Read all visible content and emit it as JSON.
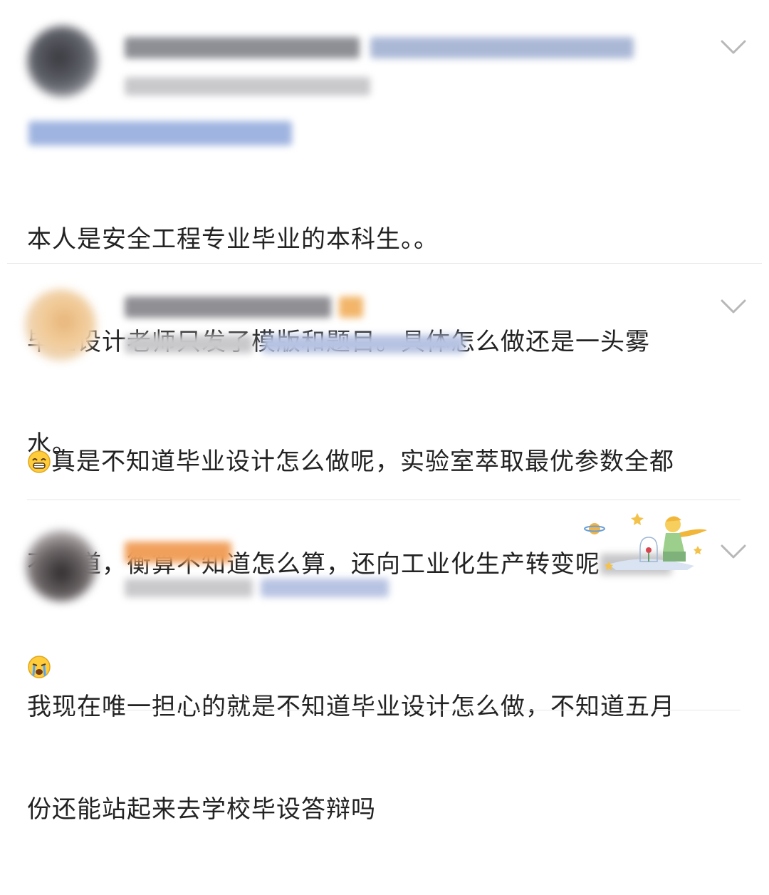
{
  "comments": [
    {
      "content_lines": [
        "本人是安全工程专业毕业的本科生。。",
        "毕业设计老师只发了模版和题目。具体怎么做还是一头雾",
        "水。"
      ]
    },
    {
      "content_line1": "真是不知道毕业设计怎么做呢，实验室萃取最优参数全都",
      "content_line2": "不知道，衡算不知道怎么算，还向工业化生产转变呢",
      "leading_emoji": "grinning-face-icon",
      "trailing_emoji": "crying-face-icon"
    },
    {
      "content_lines": [
        "我现在唯一担心的就是不知道毕业设计怎么做，不知道五月",
        "份还能站起来去学校毕设答辩吗"
      ]
    }
  ],
  "colors": {
    "text": "#222222",
    "divider": "#e6e6e6",
    "chevron": "#b8b8b8",
    "link_blur": "#9fb4e0"
  }
}
